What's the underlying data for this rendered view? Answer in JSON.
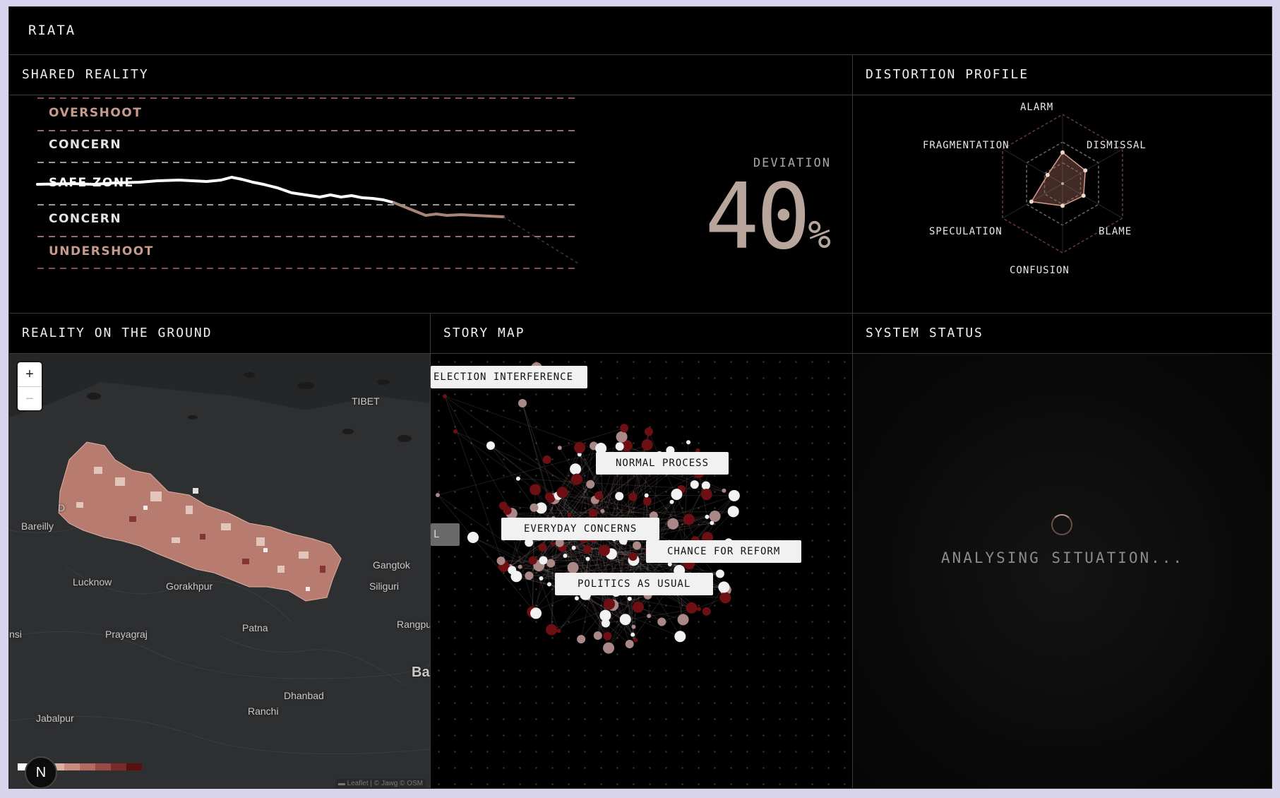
{
  "app": {
    "title": "RIATA"
  },
  "shared_reality": {
    "title": "SHARED REALITY",
    "zones": [
      {
        "label": "OVERSHOOT",
        "color": "#c79a8e"
      },
      {
        "label": "CONCERN",
        "color": "#e3e3e3"
      },
      {
        "label": "SAFE ZONE",
        "color": "#ffffff"
      },
      {
        "label": "CONCERN",
        "color": "#e3e3e3"
      },
      {
        "label": "UNDERSHOOT",
        "color": "#c79a8e"
      }
    ],
    "deviation_label": "DEVIATION",
    "deviation_value": "40",
    "deviation_unit": "%"
  },
  "distortion_profile": {
    "title": "DISTORTION PROFILE",
    "axes": [
      "ALARM",
      "DISMISSAL",
      "BLAME",
      "CONFUSION",
      "SPECULATION",
      "FRAGMENTATION"
    ],
    "values": [
      0.45,
      0.38,
      0.35,
      0.32,
      0.52,
      0.25
    ]
  },
  "reality_on_ground": {
    "title": "REALITY ON THE GROUND",
    "zoom_in": "+",
    "zoom_out": "−",
    "compass": "N",
    "attribution": "▬ Leaflet | © Jawg © OSM",
    "places": [
      "TIBET",
      "Bareilly",
      "Lucknow",
      "Gorakhpur",
      "Gangtok",
      "Siliguri",
      "Prayagraj",
      "Patna",
      "Rangpu",
      "Dhanbad",
      "Ranchi",
      "Jabalpur",
      "Ba",
      "nsi",
      "D"
    ],
    "legend_colors": [
      "#ffffff",
      "#e8cfc4",
      "#d9b0a2",
      "#c98b7c",
      "#b56a5e",
      "#9a4a44",
      "#7a2a2a",
      "#5a1010"
    ]
  },
  "story_map": {
    "title": "STORY MAP",
    "tags": [
      "ELECTION INTERFERENCE",
      "NORMAL PROCESS",
      "EVERYDAY CONCERNS",
      "CHANCE FOR REFORM",
      "POLITICS AS USUAL",
      "L"
    ]
  },
  "system_status": {
    "title": "SYSTEM STATUS",
    "message": "ANALYSING SITUATION..."
  }
}
